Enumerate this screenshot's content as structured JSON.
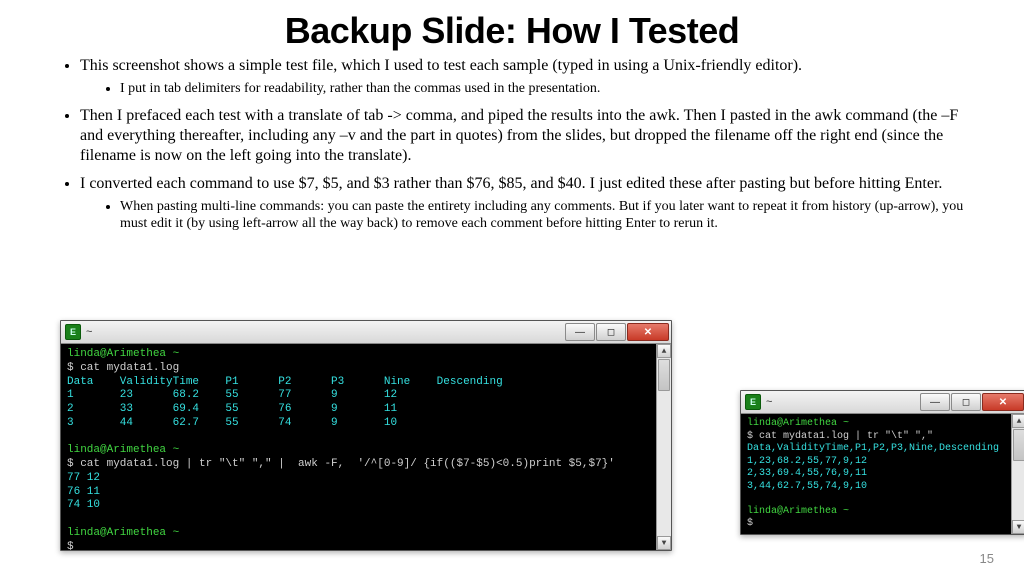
{
  "title": "Backup Slide: How I Tested",
  "bullets": {
    "b1": "This screenshot shows a simple test file, which I used to test each sample (typed in using a Unix-friendly editor).",
    "b1a": "I put in tab delimiters for readability, rather than the commas used in the presentation.",
    "b2": "Then I prefaced each test with a translate of tab -> comma, and piped the results into the awk.  Then I pasted in the awk command (the –F and everything thereafter, including any –v and the part in quotes) from the slides, but dropped the filename off the right end (since the filename is now on the left going into the translate).",
    "b3": "I converted each command to use $7, $5, and $3 rather than $76, $85, and $40.  I just edited these after pasting but before hitting Enter.",
    "b3a": "When pasting multi-line commands: you can paste the entirety including any comments.  But if you later want to repeat it from history (up-arrow), you must edit it (by using left-arrow all the way back) to remove each comment before hitting Enter to rerun it."
  },
  "term1": {
    "title": "~",
    "prompt1": "linda@Arimethea ~",
    "cmd1": "$ cat mydata1.log",
    "header": "Data    ValidityTime    P1      P2      P3      Nine    Descending",
    "row1": "1       23      68.2    55      77      9       12",
    "row2": "2       33      69.4    55      76      9       11",
    "row3": "3       44      62.7    55      74      9       10",
    "prompt2": "linda@Arimethea ~",
    "cmd2": "$ cat mydata1.log | tr \"\\t\" \",\" |  awk -F,  '/^[0-9]/ {if(($7-$5)<0.5)print $5,$7}'",
    "out1": "77 12",
    "out2": "76 11",
    "out3": "74 10",
    "prompt3": "linda@Arimethea ~",
    "cmd3": "$ "
  },
  "term2": {
    "title": "~",
    "prompt1": "linda@Arimethea ~",
    "cmd1": "$ cat mydata1.log | tr \"\\t\" \",\"",
    "row1": "Data,ValidityTime,P1,P2,P3,Nine,Descending",
    "row2": "1,23,68.2,55,77,9,12",
    "row3": "2,33,69.4,55,76,9,11",
    "row4": "3,44,62.7,55,74,9,10",
    "prompt2": "linda@Arimethea ~",
    "cmd2": "$"
  },
  "pageNumber": "15"
}
